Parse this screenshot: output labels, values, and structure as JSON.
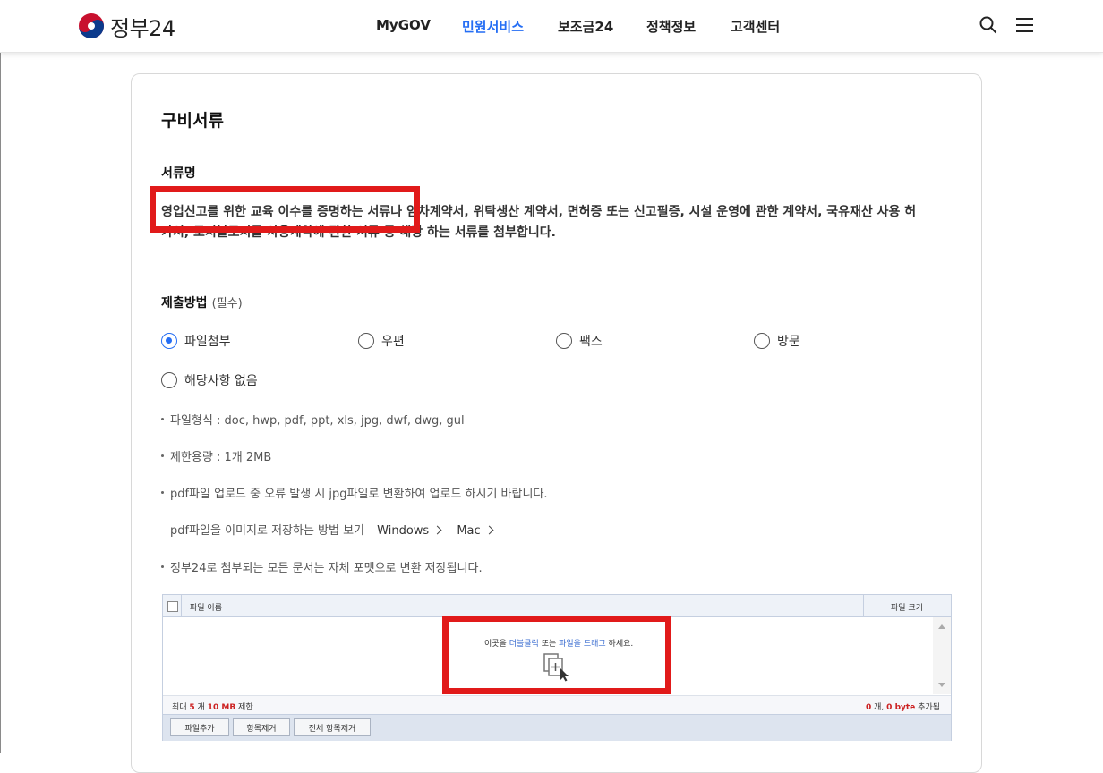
{
  "header": {
    "logo_text": "정부24",
    "nav": [
      {
        "label": "MyGOV",
        "active": false
      },
      {
        "label": "민원서비스",
        "active": true
      },
      {
        "label": "보조금24",
        "active": false
      },
      {
        "label": "정책정보",
        "active": false
      },
      {
        "label": "고객센터",
        "active": false
      }
    ],
    "icons": [
      "search-icon",
      "menu-icon"
    ]
  },
  "section": {
    "title": "구비서류",
    "doc_name_label": "서류명",
    "doc_desc_line1": "영업신고를 위한 교육 이수를 증명하는 서류나 임차계약서, 위탁생산 계약서, 면허증 또는 신고필증, 시설 운영에 관한 계약서, 국유재산 사용 허",
    "doc_desc_line2": "가서, 토지불모지를 사용계약에 관한 서류 등 해당 하는 서류를 첨부합니다."
  },
  "submit": {
    "label": "제출방법",
    "required": "(필수)",
    "options": [
      {
        "label": "파일첨부",
        "selected": true
      },
      {
        "label": "우편",
        "selected": false
      },
      {
        "label": "팩스",
        "selected": false
      },
      {
        "label": "방문",
        "selected": false
      },
      {
        "label": "해당사항 없음",
        "selected": false
      }
    ]
  },
  "notes": {
    "format": "파일형식 : doc, hwp, pdf, ppt, xls, jpg, dwf, dwg, gul",
    "limit": "제한용량 : 1개 2MB",
    "pdf_error": "pdf파일 업로드 중 오류 발생 시 jpg파일로 변환하여 업로드 하시기 바랍니다.",
    "how_to": "pdf파일을 이미지로 저장하는 방법 보기",
    "link_windows": "Windows",
    "link_mac": "Mac",
    "convert": "정부24로 첨부되는 모든 문서는 자체 포맷으로 변환 저장됩니다."
  },
  "uploader": {
    "col_name": "파일 이름",
    "col_size": "파일 크기",
    "drop_pre": "이곳을 ",
    "drop_dbl": "더블클릭",
    "drop_mid": " 또는 ",
    "drop_drag": "파일을 드래그",
    "drop_post": " 하세요.",
    "limit_pre": "최대 ",
    "limit_count": "5",
    "limit_mid": " 개 ",
    "limit_size": "10 MB",
    "limit_post": " 제한",
    "added_count": "0",
    "added_mid": " 개, ",
    "added_size": "0 byte",
    "added_post": " 추가됨",
    "btn_add": "파일추가",
    "btn_remove": "항목제거",
    "btn_remove_all": "전체 항목제거"
  },
  "colors": {
    "accent": "#256ef4",
    "highlight": "#e11a1a"
  }
}
